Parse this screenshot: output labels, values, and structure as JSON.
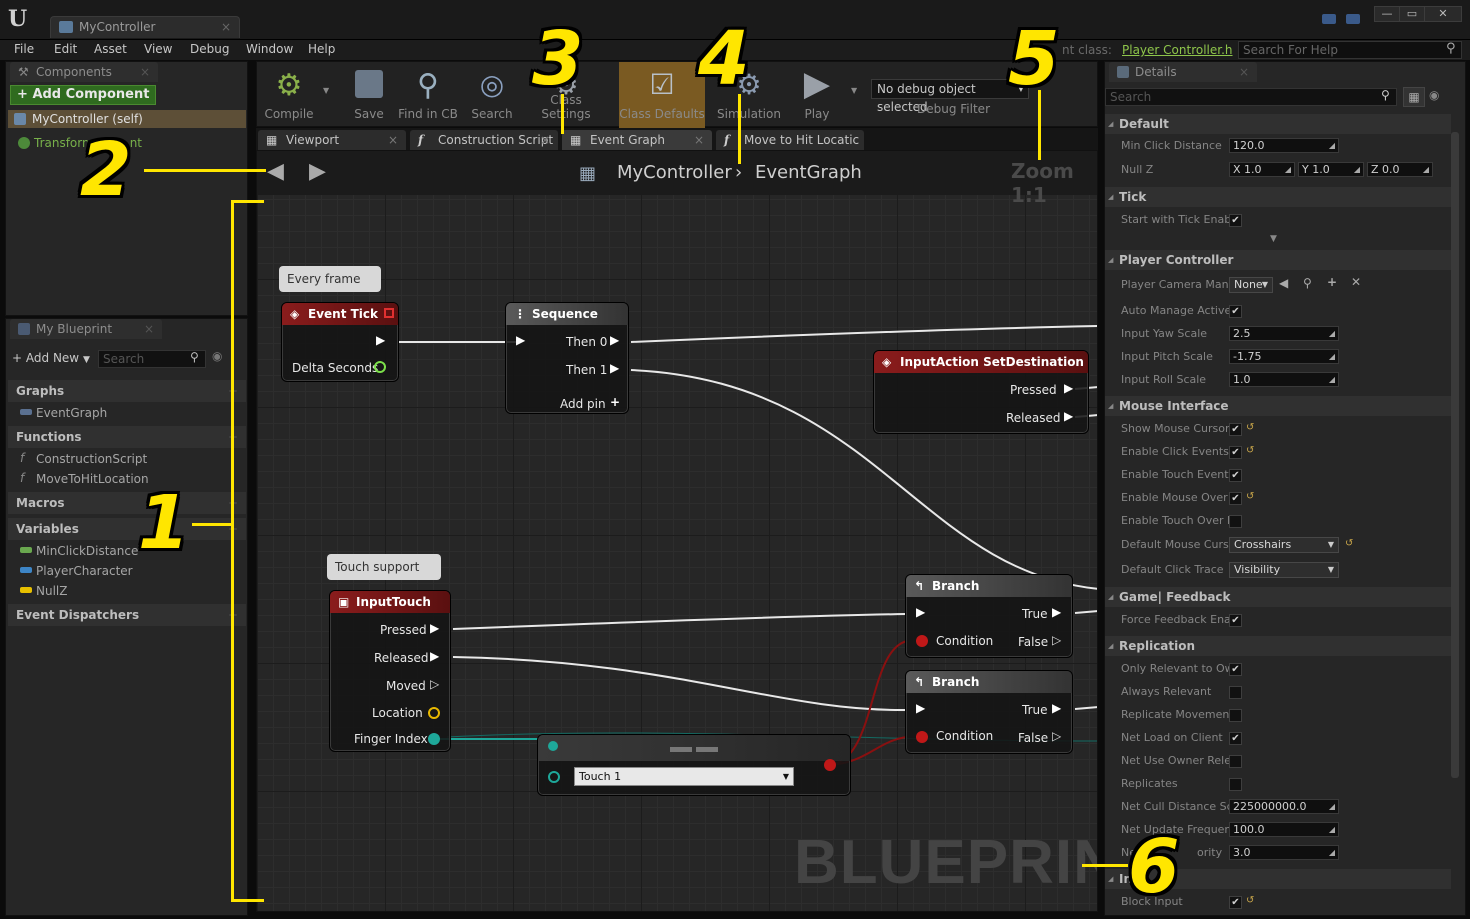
{
  "window": {
    "doc_tab": "MyController",
    "buttons": [
      "—",
      "▭",
      "✕"
    ]
  },
  "menu": {
    "items": [
      "File",
      "Edit",
      "Asset",
      "View",
      "Debug",
      "Window",
      "Help"
    ],
    "parent_class_label": "nt class:",
    "parent_class_value": "Player Controller.h",
    "help_search_placeholder": "Search For Help"
  },
  "components": {
    "tab": "Components",
    "add_button": "Add Component",
    "self_item": "MyController (self)",
    "transform_item": "Transform",
    "transform_item_tail": "nt"
  },
  "my_blueprint": {
    "tab": "My Blueprint",
    "add_new": "Add New",
    "search_placeholder": "Search",
    "categories": {
      "graphs": "Graphs",
      "functions": "Functions",
      "macros": "Macros",
      "variables": "Variables",
      "dispatchers": "Event Dispatchers"
    },
    "graphs": [
      "EventGraph"
    ],
    "functions": [
      "ConstructionScript",
      "MoveToHitLocation"
    ],
    "variables": [
      "MinClickDistance",
      "PlayerCharacter",
      "NullZ"
    ],
    "variable_colors": [
      "#6aa84f",
      "#3d85c6",
      "#e8c000"
    ]
  },
  "toolbar": {
    "compile": "Compile",
    "save": "Save",
    "find_in_cb": "Find in CB",
    "search": "Search",
    "class_settings": "Class Settings",
    "class_defaults": "Class Defaults",
    "simulation": "Simulation",
    "play": "Play",
    "debug_select": "No debug object selected",
    "debug_filter": "Debug Filter"
  },
  "graph_tabs": [
    "Viewport",
    "Construction Script",
    "Event Graph",
    "Move to Hit Locatic"
  ],
  "graph": {
    "breadcrumb_owner": "MyController",
    "breadcrumb_sep": "›",
    "breadcrumb_graph": "EventGraph",
    "zoom": "Zoom 1:1",
    "watermark": "BLUEPRINT",
    "comments": {
      "every_frame": "Every frame",
      "touch_support": "Touch support"
    },
    "nodes": {
      "event_tick": {
        "title": "Event Tick",
        "pin_delta": "Delta Seconds"
      },
      "sequence": {
        "title": "Sequence",
        "then0": "Then 0",
        "then1": "Then 1",
        "add_pin": "Add pin"
      },
      "input_action": {
        "title": "InputAction SetDestination",
        "pressed": "Pressed",
        "released": "Released"
      },
      "input_touch": {
        "title": "InputTouch",
        "pressed": "Pressed",
        "released": "Released",
        "moved": "Moved",
        "location": "Location",
        "finger_index": "Finger Index"
      },
      "branch1": {
        "title": "Branch",
        "condition": "Condition",
        "true": "True",
        "false": "False"
      },
      "branch2": {
        "title": "Branch",
        "condition": "Condition",
        "true": "True",
        "false": "False"
      },
      "equal_node": {
        "value": "Touch 1"
      }
    }
  },
  "details": {
    "tab": "Details",
    "search_placeholder": "Search",
    "sections": {
      "default": "Default",
      "tick": "Tick",
      "player_controller": "Player Controller",
      "mouse_interface": "Mouse Interface",
      "game_feedback": "Game| Feedback",
      "replication": "Replication",
      "input": "Inp"
    },
    "rows": {
      "min_click_distance": {
        "label": "Min Click Distance",
        "value": "120.0"
      },
      "null_z": {
        "label": "Null Z",
        "x": "X  1.0",
        "y": "Y  1.0",
        "z": "Z  0.0"
      },
      "start_with_tick": {
        "label": "Start with Tick Enab"
      },
      "player_camera_manager": {
        "label": "Player Camera Mana",
        "value": "None"
      },
      "auto_manage_active": {
        "label": "Auto Manage Active"
      },
      "input_yaw_scale": {
        "label": "Input Yaw Scale",
        "value": "2.5"
      },
      "input_pitch_scale": {
        "label": "Input Pitch Scale",
        "value": "-1.75"
      },
      "input_roll_scale": {
        "label": "Input Roll Scale",
        "value": "1.0"
      },
      "show_mouse_cursor": {
        "label": "Show Mouse Cursor"
      },
      "enable_click_events": {
        "label": "Enable Click Events"
      },
      "enable_touch_events": {
        "label": "Enable Touch Events"
      },
      "enable_mouse_over": {
        "label": "Enable Mouse Over"
      },
      "enable_touch_over": {
        "label": "Enable Touch Over E"
      },
      "default_mouse_cursor": {
        "label": "Default Mouse Curso",
        "value": "Crosshairs"
      },
      "default_click_trace": {
        "label": "Default Click Trace",
        "value": "Visibility"
      },
      "force_feedback": {
        "label": "Force Feedback Ena"
      },
      "only_relevant_owner": {
        "label": "Only Relevant to Ow"
      },
      "always_relevant": {
        "label": "Always Relevant"
      },
      "replicate_movement": {
        "label": "Replicate Movemen"
      },
      "net_load_on_client": {
        "label": "Net Load on Client"
      },
      "net_use_owner_relevancy": {
        "label": "Net Use Owner Rele"
      },
      "replicates": {
        "label": "Replicates"
      },
      "net_cull_distance": {
        "label": "Net Cull Distance Sc",
        "value": "225000000.0"
      },
      "net_update_frequency": {
        "label": "Net Update Frequenc",
        "value": "100.0"
      },
      "net_priority": {
        "label": "Net",
        "label_tail": "ority",
        "value": "3.0"
      },
      "block_input": {
        "label": "Block Input"
      }
    }
  },
  "annotations": [
    "1",
    "2",
    "3",
    "4",
    "5",
    "6"
  ],
  "colors": {
    "annotation": "#ffe600",
    "event_header": "#8a1c1c",
    "add_component": "#2f6b1f",
    "class_defaults": "#7a5a22"
  }
}
